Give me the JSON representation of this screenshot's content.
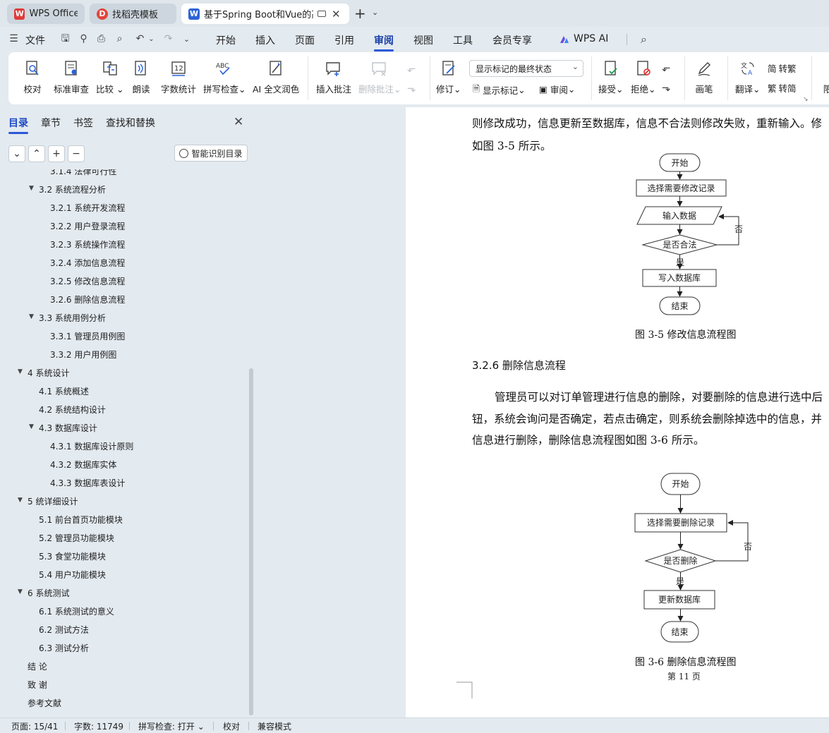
{
  "tabs": [
    {
      "label": "WPS Office",
      "logo": "W",
      "logo_color": "#e03a3a"
    },
    {
      "label": "找稻壳模板",
      "logo": "D",
      "logo_color": "#e0463a"
    },
    {
      "label": "基于Spring Boot和Vue的高",
      "logo": "W",
      "logo_color": "#2b62d8"
    }
  ],
  "menu": {
    "file": "文件",
    "items": [
      "开始",
      "插入",
      "页面",
      "引用",
      "审阅",
      "视图",
      "工具",
      "会员专享",
      "WPS AI"
    ],
    "active": "审阅"
  },
  "ribbon": {
    "proofread": "校对",
    "std_review": "标准审查",
    "compare": "比较",
    "read_aloud": "朗读",
    "word_count": "字数统计",
    "spell_check": "拼写检查",
    "ai_polish": "AI 全文润色",
    "insert_comment": "插入批注",
    "delete_comment": "删除批注",
    "track_changes": "修订",
    "markup_select": "显示标记的最终状态",
    "show_markup": "显示标记",
    "review": "审阅",
    "accept": "接受",
    "reject": "拒绝",
    "pen": "画笔",
    "translate": "翻译",
    "to_traditional": "转繁",
    "to_simplified": "转简",
    "restrict": "限"
  },
  "panel": {
    "tabs": [
      "目录",
      "章节",
      "书签",
      "查找和替换"
    ],
    "smart_btn": "智能识别目录",
    "toc": [
      {
        "text": "3.1.4 法律可行性",
        "level": 3,
        "arrow": false
      },
      {
        "text": "3.2 系统流程分析",
        "level": 2,
        "arrow": true
      },
      {
        "text": "3.2.1 系统开发流程",
        "level": 3,
        "arrow": false
      },
      {
        "text": "3.2.2  用户登录流程",
        "level": 3,
        "arrow": false
      },
      {
        "text": "3.2.3  系统操作流程",
        "level": 3,
        "arrow": false
      },
      {
        "text": "3.2.4  添加信息流程",
        "level": 3,
        "arrow": false
      },
      {
        "text": "3.2.5  修改信息流程",
        "level": 3,
        "arrow": false
      },
      {
        "text": "3.2.6  删除信息流程",
        "level": 3,
        "arrow": false
      },
      {
        "text": "3.3 系统用例分析",
        "level": 2,
        "arrow": true
      },
      {
        "text": "3.3.1 管理员用例图",
        "level": 3,
        "arrow": false
      },
      {
        "text": "3.3.2 用户用例图",
        "level": 3,
        "arrow": false
      },
      {
        "text": "4  系统设计",
        "level": 1,
        "arrow": true
      },
      {
        "text": "4.1  系统概述",
        "level": 2,
        "arrow": false
      },
      {
        "text": "4.2  系统结构设计",
        "level": 2,
        "arrow": false
      },
      {
        "text": "4.3 数据库设计",
        "level": 2,
        "arrow": true
      },
      {
        "text": "4.3.1  数据库设计原则",
        "level": 3,
        "arrow": false
      },
      {
        "text": "4.3.2  数据库实体",
        "level": 3,
        "arrow": false
      },
      {
        "text": "4.3.3  数据库表设计",
        "level": 3,
        "arrow": false
      },
      {
        "text": "5 统详细设计",
        "level": 1,
        "arrow": true
      },
      {
        "text": "5.1 前台首页功能模块",
        "level": 2,
        "arrow": false
      },
      {
        "text": "5.2 管理员功能模块",
        "level": 2,
        "arrow": false
      },
      {
        "text": "5.3 食堂功能模块",
        "level": 2,
        "arrow": false
      },
      {
        "text": "5.4 用户功能模块",
        "level": 2,
        "arrow": false
      },
      {
        "text": "6 系统测试",
        "level": 1,
        "arrow": true
      },
      {
        "text": "6.1 系统测试的意义",
        "level": 2,
        "arrow": false
      },
      {
        "text": "6.2  测试方法",
        "level": 2,
        "arrow": false
      },
      {
        "text": "6.3 测试分析",
        "level": 2,
        "arrow": false
      },
      {
        "text": "结      论",
        "level": 1,
        "arrow": false
      },
      {
        "text": "致      谢",
        "level": 1,
        "arrow": false
      },
      {
        "text": "参考文献",
        "level": 1,
        "arrow": false
      }
    ]
  },
  "doc": {
    "para1_line1": "则修改成功，信息更新至数据库，信息不合法则修改失败，重新输入。修",
    "para1_line2": "如图 3-5 所示。",
    "fig1": {
      "start": "开始",
      "select": "选择需要修改记录",
      "input": "输入数据",
      "decide": "是否合法",
      "no": "否",
      "yes": "是",
      "write": "写入数据库",
      "end": "结束",
      "caption": "图 3-5  修改信息流程图"
    },
    "heading": "3.2.6  删除信息流程",
    "para2_line1": "管理员可以对订单管理进行信息的删除，对要删除的信息进行选中后",
    "para2_line2": "钮，系统会询问是否确定，若点击确定，则系统会删除掉选中的信息，并",
    "para2_line3": "信息进行删除，删除信息流程图如图 3-6 所示。",
    "fig2": {
      "start": "开始",
      "select": "选择需要删除记录",
      "decide": "是否删除",
      "no": "否",
      "yes": "是",
      "update": "更新数据库",
      "end": "结束",
      "caption": "图 3-6  删除信息流程图"
    },
    "page_number": "第  11  页"
  },
  "status": {
    "page": "页面: 15/41",
    "words": "字数: 11749",
    "spell": "拼写检查: 打开",
    "proof": "校对",
    "compat": "兼容模式"
  }
}
